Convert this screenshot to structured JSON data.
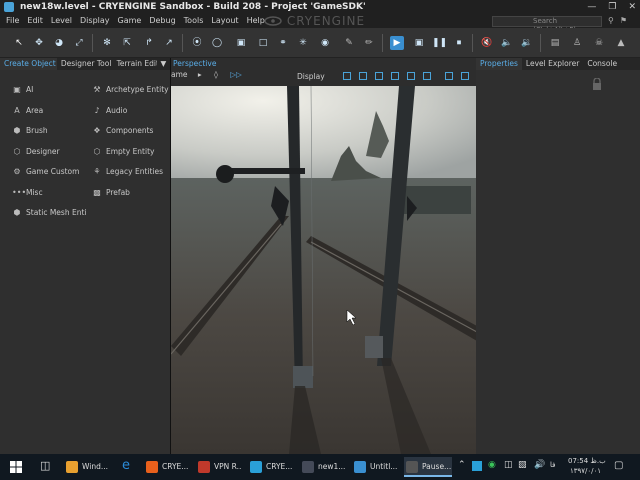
{
  "window": {
    "title": "new18w.level - CRYENGINE Sandbox - Build 208 - Project 'GameSDK'",
    "buttons": [
      "—",
      "❐",
      "✕"
    ]
  },
  "menu": {
    "items": [
      "File",
      "Edit",
      "Level",
      "Display",
      "Game",
      "Debug",
      "Tools",
      "Layout",
      "Help"
    ],
    "logo": "CRYENGINE",
    "search_placeholder": "Search (Ctrl+Alt+F)"
  },
  "left_panel": {
    "tabs": [
      "Create Object",
      "Designer Tool",
      "Terrain Edit"
    ],
    "dropdown_arrow": "▼",
    "objects": [
      {
        "label": "AI",
        "icon": "ai-icon",
        "glyph": "▣"
      },
      {
        "label": "Archetype Entity",
        "icon": "archetype-icon",
        "glyph": "⚒"
      },
      {
        "label": "Area",
        "icon": "area-icon",
        "glyph": "A"
      },
      {
        "label": "Audio",
        "icon": "speaker-icon",
        "glyph": "♪"
      },
      {
        "label": "Brush",
        "icon": "brush-icon",
        "glyph": "⬢"
      },
      {
        "label": "Components",
        "icon": "components-icon",
        "glyph": "❖"
      },
      {
        "label": "Designer",
        "icon": "designer-icon",
        "glyph": "⬡"
      },
      {
        "label": "Empty Entity",
        "icon": "empty-entity-icon",
        "glyph": "⬡"
      },
      {
        "label": "Game Custom",
        "icon": "game-custom-icon",
        "glyph": "⚙"
      },
      {
        "label": "Legacy Entities",
        "icon": "legacy-entities-icon",
        "glyph": "⚘"
      },
      {
        "label": "Misc",
        "icon": "misc-icon",
        "glyph": "•••"
      },
      {
        "label": "Prefab",
        "icon": "prefab-icon",
        "glyph": "▩"
      },
      {
        "label": "Static Mesh Enti",
        "icon": "static-mesh-icon",
        "glyph": "⬢"
      }
    ]
  },
  "viewport": {
    "title": "Perspective",
    "camera_label": "ame",
    "display_label": "Display"
  },
  "right_panel": {
    "tabs": [
      "Properties",
      "Level Explorer",
      "Console"
    ]
  },
  "taskbar": {
    "items": [
      {
        "label": "Wind...",
        "color": "#e8a030"
      },
      {
        "label": "CRYE...",
        "color": "#e8601c"
      },
      {
        "label": "VPN R...",
        "color": "#c0392b"
      },
      {
        "label": "CRYE...",
        "color": "#2aa0d8"
      },
      {
        "label": "new1...",
        "color": "#444a58"
      },
      {
        "label": "Untitl...",
        "color": "#3a8fd0"
      },
      {
        "label": "Pause...",
        "color": "#555555"
      }
    ],
    "time": "07:54 ب.ظ",
    "date": "۱۳۹۷/۰/۰۱",
    "lang": "فا"
  }
}
